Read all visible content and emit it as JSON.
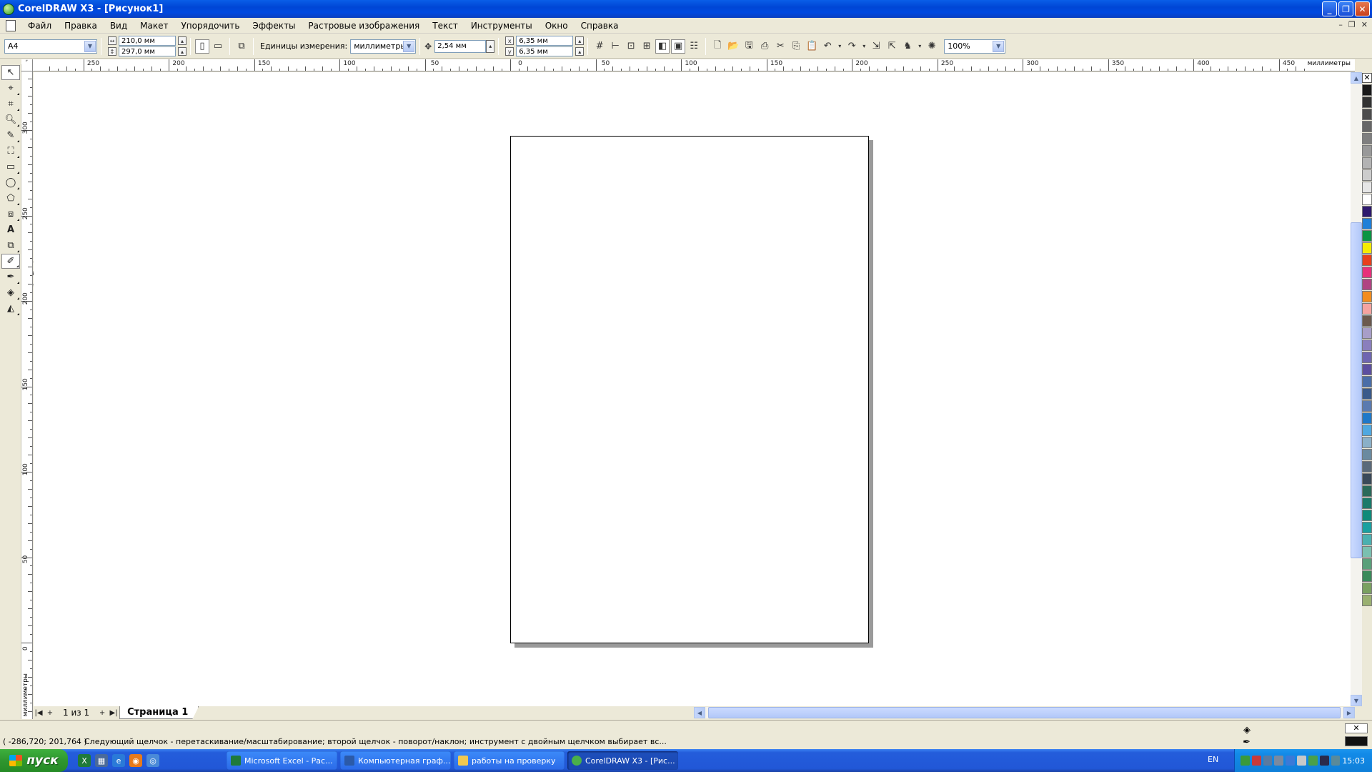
{
  "window": {
    "title": "CorelDRAW X3 - [Рисунок1]",
    "minimize": "_",
    "restore": "❐",
    "close": "✕"
  },
  "menu": {
    "items": [
      "Файл",
      "Правка",
      "Вид",
      "Макет",
      "Упорядочить",
      "Эффекты",
      "Растровые изображения",
      "Текст",
      "Инструменты",
      "Окно",
      "Справка"
    ],
    "mdi_controls": [
      "–",
      "❐",
      "✕"
    ]
  },
  "property_bar": {
    "paper_size": "A4",
    "width": "210,0 мм",
    "height": "297,0 мм",
    "units_label": "Единицы измерения:",
    "units_value": "миллиметры",
    "nudge": "2,54 мм",
    "duplicate_x": "6,35 мм",
    "duplicate_y": "6,35 мм",
    "zoom": "100%"
  },
  "rulers": {
    "units": "миллиметры",
    "h_labels": [
      "250",
      "200",
      "150",
      "100",
      "50",
      "0",
      "50",
      "100",
      "150",
      "200",
      "250",
      "300",
      "350",
      "400",
      "450"
    ],
    "v_labels": [
      "300",
      "250",
      "200",
      "150",
      "100",
      "50",
      "0"
    ]
  },
  "page_nav": {
    "count": "1 из 1",
    "tab": "Страница 1"
  },
  "palette": {
    "colors": [
      "#1a1a1a",
      "#333333",
      "#4d4d4d",
      "#666666",
      "#7f7f7f",
      "#999999",
      "#b3b3b3",
      "#cccccc",
      "#e6e6e6",
      "#ffffff",
      "#2e1a6e",
      "#1e7fd8",
      "#0b9444",
      "#f5ec00",
      "#e8401c",
      "#e8307a",
      "#b04482",
      "#f28c1e",
      "#f5a3a0",
      "#6b5a4e",
      "#a89ec8",
      "#8a7fbd",
      "#6f66b0",
      "#5c4fa0",
      "#4a6ea8",
      "#3a5a8a",
      "#5a7ab0",
      "#1f78c8",
      "#4fa8e0",
      "#8ab0c8",
      "#6a8aa0",
      "#5a6a7a",
      "#3a4a5a",
      "#2a6a5a",
      "#1a7a6a",
      "#0f8a7a",
      "#1aa0a0",
      "#4ab0b0",
      "#7ac0b0",
      "#5aa07a",
      "#3a8a5a",
      "#7aa060",
      "#9ab070"
    ]
  },
  "status": {
    "coords": "( -286,720; 201,764 )",
    "hint": "Следующий щелчок - перетаскивание/масштабирование; второй щелчок - поворот/наклон; инструмент с двойным щелчком выбирает вс..."
  },
  "taskbar": {
    "start": "пуск",
    "tasks": [
      {
        "label": "Microsoft Excel - Рас...",
        "color": "#1f7a3a"
      },
      {
        "label": "Компьютерная граф...",
        "color": "#2b5aa8"
      },
      {
        "label": "работы на проверку",
        "color": "#f0c850"
      },
      {
        "label": "CorelDRAW X3 - [Рис...",
        "color": "#4ab04a"
      }
    ],
    "lang": "EN",
    "clock": "15:03"
  }
}
